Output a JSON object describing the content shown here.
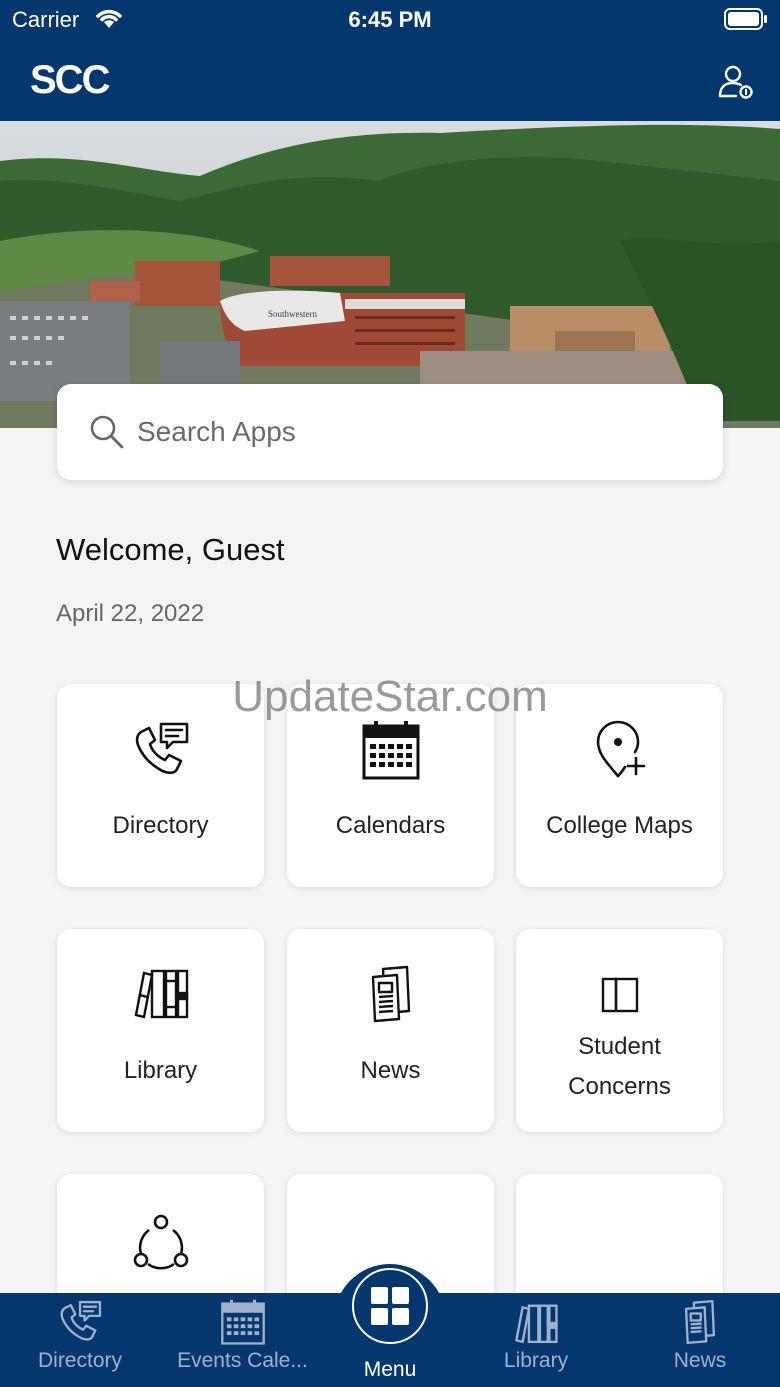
{
  "status_bar": {
    "carrier": "Carrier",
    "time": "6:45 PM"
  },
  "header": {
    "logo_text": "SCC"
  },
  "hero": {
    "building_sign": "Southwestern"
  },
  "search": {
    "placeholder": "Search Apps"
  },
  "welcome": {
    "greeting": "Welcome, Guest",
    "date": "April 22, 2022"
  },
  "watermark": "UpdateStar.com",
  "tiles": [
    {
      "label": "Directory",
      "icon": "phone-chat-icon"
    },
    {
      "label": "Calendars",
      "icon": "calendar-icon"
    },
    {
      "label": "College Maps",
      "icon": "map-pin-plus-icon"
    },
    {
      "label": "Library",
      "icon": "books-icon"
    },
    {
      "label": "News",
      "icon": "newspaper-icon"
    },
    {
      "label": "Student Concerns",
      "label_line1": "Student",
      "label_line2": "Concerns",
      "icon": "panels-icon"
    },
    {
      "label": "",
      "icon": "share-circle-icon"
    },
    {
      "label": "",
      "icon": ""
    },
    {
      "label": "",
      "icon": ""
    }
  ],
  "tabbar": {
    "items": [
      {
        "label": "Directory",
        "icon": "phone-chat-icon"
      },
      {
        "label": "Events Cale...",
        "icon": "calendar-icon"
      },
      {
        "label": "Menu",
        "icon": "grid-icon"
      },
      {
        "label": "Library",
        "icon": "books-icon"
      },
      {
        "label": "News",
        "icon": "newspaper-icon"
      }
    ]
  },
  "colors": {
    "primary": "#05376f",
    "background": "#f4f4f4",
    "tab_inactive": "#9fb2cc"
  }
}
